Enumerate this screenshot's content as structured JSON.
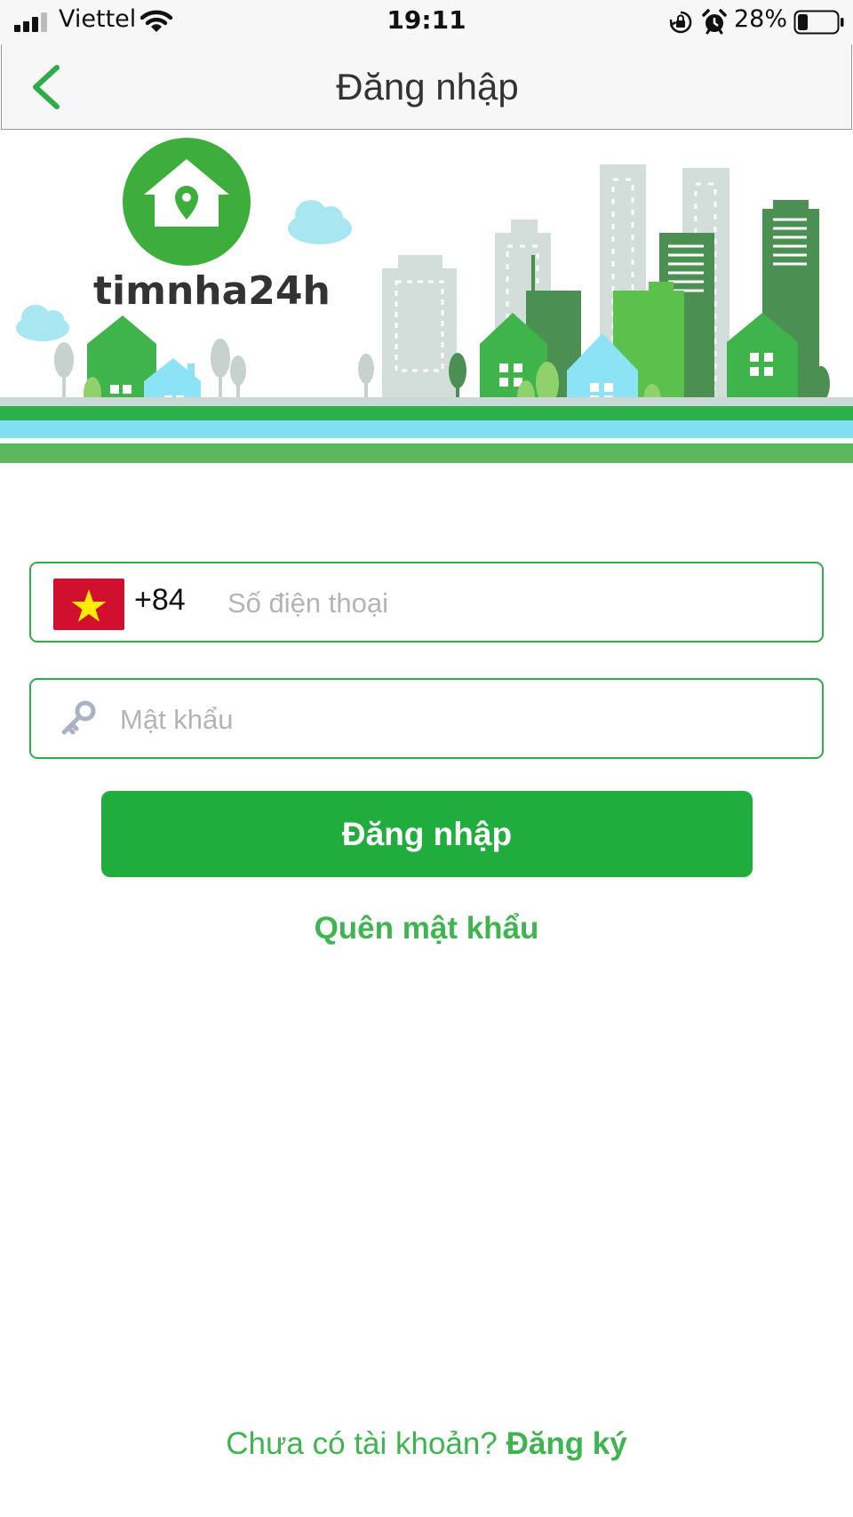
{
  "status_bar": {
    "carrier": "Viettel",
    "time": "19:11",
    "battery_percent": "28%",
    "icons": [
      "signal-icon",
      "wifi-icon",
      "orientation-lock-icon",
      "alarm-icon",
      "battery-icon"
    ]
  },
  "nav": {
    "title": "Đăng nhập",
    "back_icon": "chevron-left-icon",
    "accent_color": "#2eac4a"
  },
  "banner": {
    "logo_text": "timnha24h",
    "logo_icon": "house-pin-icon"
  },
  "form": {
    "phone": {
      "flag_icon": "vietnam-flag-icon",
      "country_code": "+84",
      "value": "",
      "placeholder": "Số điện thoại"
    },
    "password": {
      "icon": "key-icon",
      "value": "",
      "placeholder": "Mật khẩu"
    },
    "login_button_label": "Đăng nhập",
    "forgot_password_label": "Quên mật khẩu"
  },
  "footer": {
    "no_account_text": "Chưa có tài khoản?",
    "register_label": "Đăng ký"
  },
  "colors": {
    "primary_green": "#21ad3d",
    "link_green": "#3eb54f",
    "field_border": "#2eac4a",
    "flag_red": "#d0102e",
    "flag_star": "#ffec00"
  }
}
